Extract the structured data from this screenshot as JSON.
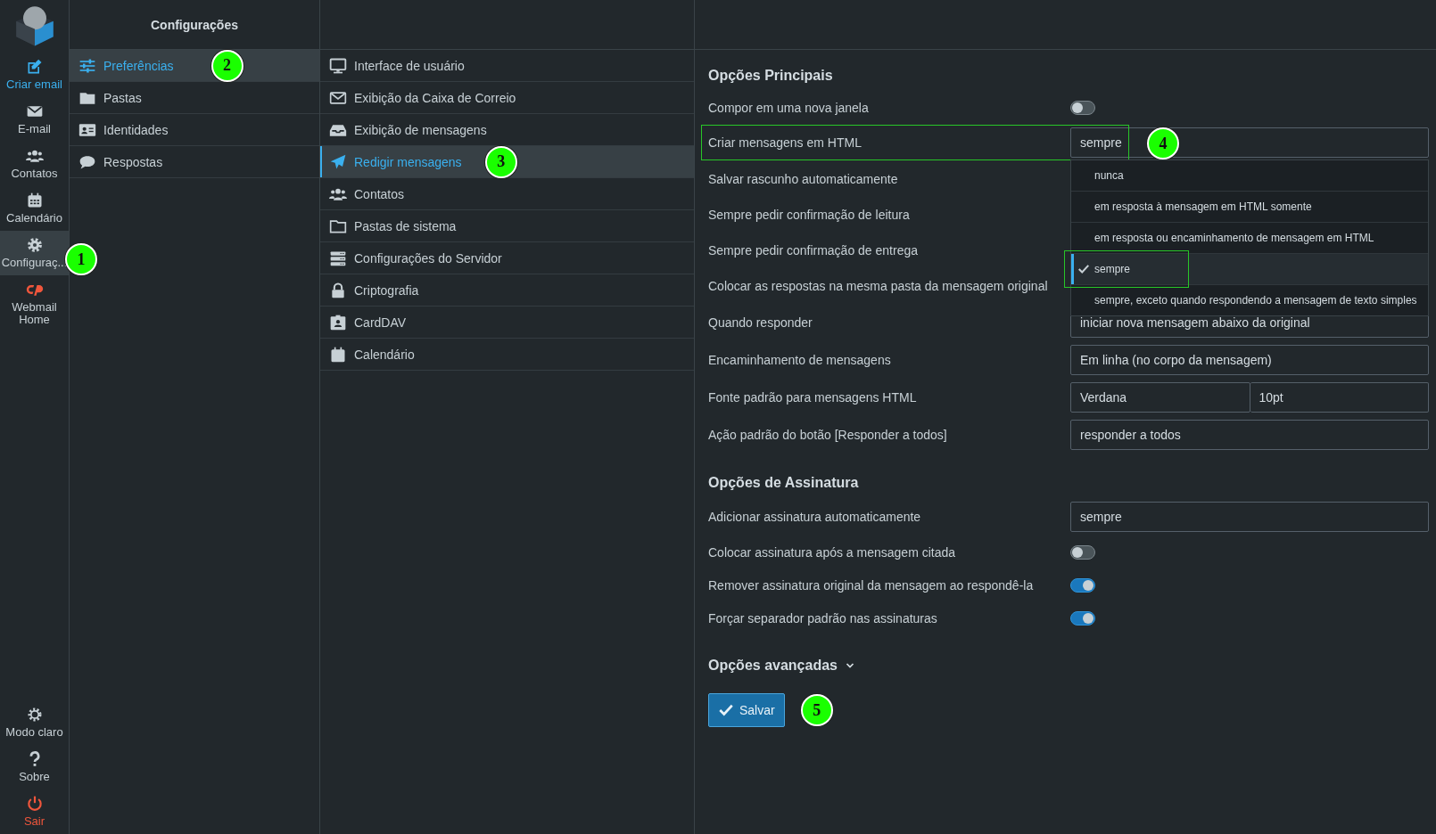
{
  "nav_items": [
    {
      "label": "Criar email",
      "kind": "primary",
      "selected": false
    },
    {
      "label": "E-mail",
      "kind": "normal",
      "selected": false
    },
    {
      "label": "Contatos",
      "kind": "normal",
      "selected": false
    },
    {
      "label": "Calendário",
      "kind": "normal",
      "selected": false
    },
    {
      "label": "Configuraç...",
      "kind": "normal",
      "selected": true,
      "callout": "1"
    },
    {
      "label": "Webmail Home",
      "kind": "normal",
      "selected": false
    }
  ],
  "nav_bottom": [
    {
      "label": "Modo claro",
      "kind": "normal"
    },
    {
      "label": "Sobre",
      "kind": "normal"
    },
    {
      "label": "Sair",
      "kind": "danger"
    }
  ],
  "sections_panel": {
    "title": "Configurações",
    "items": [
      {
        "label": "Preferências",
        "selected": true,
        "callout": "2"
      },
      {
        "label": "Pastas",
        "selected": false
      },
      {
        "label": "Identidades",
        "selected": false
      },
      {
        "label": "Respostas",
        "selected": false
      }
    ]
  },
  "preferences_panel": {
    "items": [
      {
        "label": "Interface de usuário",
        "selected": false
      },
      {
        "label": "Exibição da Caixa de Correio",
        "selected": false
      },
      {
        "label": "Exibição de mensagens",
        "selected": false
      },
      {
        "label": "Redigir mensagens",
        "selected": true,
        "callout": "3"
      },
      {
        "label": "Contatos",
        "selected": false
      },
      {
        "label": "Pastas de sistema",
        "selected": false
      },
      {
        "label": "Configurações do Servidor",
        "selected": false
      },
      {
        "label": "Criptografia",
        "selected": false
      },
      {
        "label": "CardDAV",
        "selected": false
      },
      {
        "label": "Calendário",
        "selected": false
      }
    ]
  },
  "settings": {
    "sections": [
      {
        "title": "Opções Principais",
        "rows": [
          {
            "label": "Compor em uma nova janela",
            "kind": "toggle",
            "on": false
          },
          {
            "label": "Criar mensagens em HTML",
            "kind": "select",
            "value": "sempre",
            "highlighted": true,
            "callout": "4",
            "options": [
              {
                "label": "nunca",
                "selected": false,
                "highlighted": false
              },
              {
                "label": "em resposta à mensagem em HTML somente",
                "selected": false,
                "highlighted": false
              },
              {
                "label": "em resposta ou encaminhamento de mensagem em HTML",
                "selected": false,
                "highlighted": false
              },
              {
                "label": "sempre",
                "selected": true,
                "highlighted": true
              },
              {
                "label": "sempre, exceto quando respondendo a mensagem de texto simples",
                "selected": false,
                "highlighted": false
              }
            ]
          },
          {
            "label": "Salvar rascunho automaticamente",
            "kind": "covered"
          },
          {
            "label": "Sempre pedir confirmação de leitura",
            "kind": "covered"
          },
          {
            "label": "Sempre pedir confirmação de entrega",
            "kind": "covered"
          },
          {
            "label": "Colocar as respostas na mesma pasta da mensagem original",
            "kind": "covered"
          },
          {
            "label": "Quando responder",
            "kind": "select",
            "value": "iniciar nova mensagem abaixo da original"
          },
          {
            "label": "Encaminhamento de mensagens",
            "kind": "select",
            "value": "Em linha (no corpo da mensagem)"
          },
          {
            "label": "Fonte padrão para mensagens HTML",
            "kind": "select_pair",
            "values": [
              "Verdana",
              "10pt"
            ]
          },
          {
            "label": "Ação padrão do botão [Responder a todos]",
            "kind": "select",
            "value": "responder a todos"
          }
        ]
      },
      {
        "title": "Opções de Assinatura",
        "rows": [
          {
            "label": "Adicionar assinatura automaticamente",
            "kind": "select",
            "value": "sempre"
          },
          {
            "label": "Colocar assinatura após a mensagem citada",
            "kind": "toggle",
            "on": false
          },
          {
            "label": "Remover assinatura original da mensagem ao respondê-la",
            "kind": "toggle",
            "on": true
          },
          {
            "label": "Forçar separador padrão nas assinaturas",
            "kind": "toggle",
            "on": true
          }
        ]
      }
    ],
    "advanced": {
      "title": "Opções avançadas",
      "expanded": false
    },
    "save_button": {
      "label": "Salvar",
      "callout": "5"
    }
  }
}
